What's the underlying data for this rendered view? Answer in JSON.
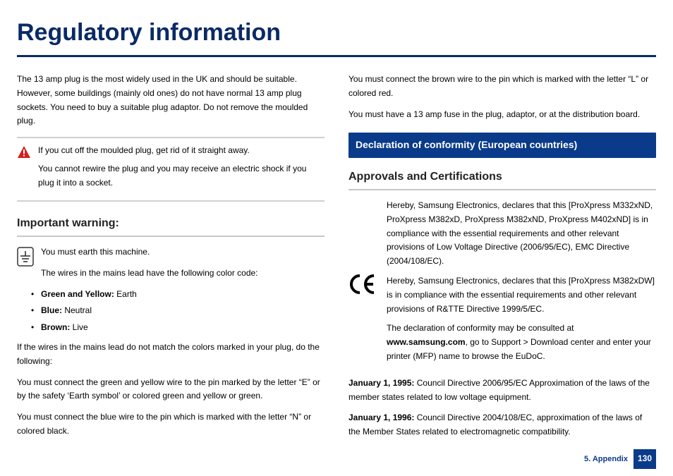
{
  "title": "Regulatory information",
  "left": {
    "p1": "The 13 amp plug is the most widely used in the UK and should be suitable. However, some buildings (mainly old ones) do not have normal 13 amp plug sockets. You need to buy a suitable plug adaptor. Do not remove the moulded plug.",
    "warnBox": {
      "l1": "If you cut off the moulded plug, get rid of it straight away.",
      "l2": "You cannot rewire the plug and you may receive an electric shock if you plug it into a socket."
    },
    "h3": "Important warning:",
    "earth1": "You must earth this machine.",
    "earth2": "The wires in the mains lead have the following color code:",
    "colors": {
      "gy_label": "Green and Yellow:",
      "gy_val": " Earth",
      "blue_label": "Blue:",
      "blue_val": " Neutral",
      "brown_label": "Brown:",
      "brown_val": " Live"
    },
    "p2": "If the wires in the mains lead do not match the colors marked in your plug, do the following:",
    "p3": "You must connect the green and yellow wire to the pin marked by the letter “E” or by the safety ‘Earth symbol’ or colored green and yellow or green.",
    "p4": "You must connect the blue wire to the pin which is marked with the letter “N” or colored black."
  },
  "right": {
    "p1": "You must connect the brown wire to the pin which is marked with the letter “L” or colored red.",
    "p2": "You must have a 13 amp fuse in the plug, adaptor, or at the distribution board.",
    "sectionBar": "Declaration of conformity (European countries)",
    "h3": "Approvals and Certifications",
    "ce1": "Hereby, Samsung Electronics, declares that this [ProXpress M332xND, ProXpress M382xD, ProXpress M382xND, ProXpress M402xND] is in compliance with the essential requirements and other relevant provisions of Low Voltage Directive (2006/95/EC), EMC Directive (2004/108/EC).",
    "ce2": "Hereby, Samsung Electronics, declares that this [ProXpress M382xDW] is in compliance with the essential requirements and other relevant provisions of R&TTE Directive 1999/5/EC.",
    "ce3a": "The declaration of conformity may be consulted at ",
    "ce3b": "www.samsung.com",
    "ce3c": ", go to Support > Download center and enter your printer (MFP) name to browse the EuDoC.",
    "dates": {
      "d1_label": "January 1, 1995:",
      "d1_text": " Council Directive 2006/95/EC Approximation of the laws of the member states related to low voltage equipment.",
      "d2_label": "January 1, 1996:",
      "d2_text": " Council Directive 2004/108/EC, approximation of the laws of the Member States related to electromagnetic compatibility."
    }
  },
  "footer": {
    "chapter": "5. Appendix",
    "page": "130"
  }
}
